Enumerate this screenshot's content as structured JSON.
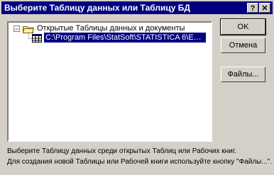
{
  "window": {
    "title": "Выберите Таблицу данных или Таблицу БД"
  },
  "titlebar": {
    "help_glyph": "?",
    "close_glyph": "✕"
  },
  "tree": {
    "expander": "−",
    "root_label": "Открытые Таблицы данных и документы",
    "child_label": "C:\\Program Files\\StatSoft\\STATISTICA 6\\Examples\\E..."
  },
  "buttons": {
    "ok": "OK",
    "cancel": "Отмена",
    "files": "Файлы..."
  },
  "hints": {
    "line1": "Выберите Таблицу данных среди открытых Таблиц или Рабочих книг.",
    "line2": "Для создания новой Таблицы или Рабочей книги используйте кнопку \"Файлы...\"."
  }
}
